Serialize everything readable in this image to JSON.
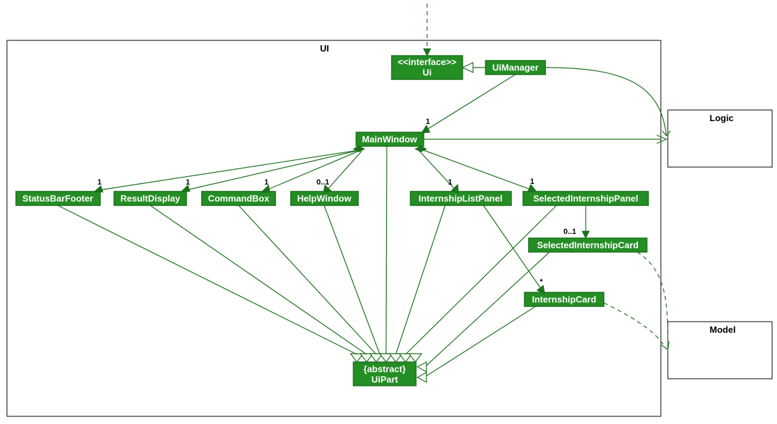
{
  "diagram": {
    "packages": {
      "ui": "UI",
      "logic": "Logic",
      "model": "Model"
    },
    "classes": {
      "ui_interface_stereotype": "<<interface>>",
      "ui_interface_name": "Ui",
      "ui_manager": "UiManager",
      "main_window": "MainWindow",
      "status_bar_footer": "StatusBarFooter",
      "result_display": "ResultDisplay",
      "command_box": "CommandBox",
      "help_window": "HelpWindow",
      "internship_list_panel": "InternshipListPanel",
      "selected_internship_panel": "SelectedInternshipPanel",
      "selected_internship_card": "SelectedInternshipCard",
      "internship_card": "InternshipCard",
      "ui_part_stereotype": "{abstract}",
      "ui_part_name": "UiPart"
    },
    "multiplicities": {
      "main_window_to_ui_manager": "1",
      "status_bar_footer": "1",
      "result_display": "1",
      "command_box": "1",
      "help_window": "0..1",
      "internship_list_panel": "1",
      "selected_internship_panel": "1",
      "selected_internship_card": "0..1",
      "internship_card": "*"
    }
  }
}
